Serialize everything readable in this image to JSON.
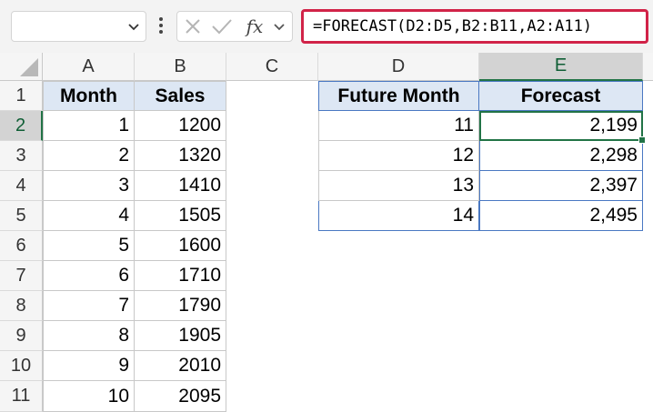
{
  "formula_bar": {
    "name_box": "",
    "formula": "=FORECAST(D2:D5,B2:B11,A2:A11)",
    "fx_label": "fx",
    "icons": [
      "chevron-down-icon",
      "more-vertical-icon",
      "cancel-icon",
      "enter-check-icon",
      "function-icon"
    ]
  },
  "columns": [
    "A",
    "B",
    "C",
    "D",
    "E"
  ],
  "rows": [
    "1",
    "2",
    "3",
    "4",
    "5",
    "6",
    "7",
    "8",
    "9",
    "10",
    "11"
  ],
  "active_cell": {
    "column": "E",
    "row": "2"
  },
  "table_left": {
    "headers": [
      "Month",
      "Sales"
    ],
    "rows": [
      [
        "1",
        "1200"
      ],
      [
        "2",
        "1320"
      ],
      [
        "3",
        "1410"
      ],
      [
        "4",
        "1505"
      ],
      [
        "5",
        "1600"
      ],
      [
        "6",
        "1710"
      ],
      [
        "7",
        "1790"
      ],
      [
        "8",
        "1905"
      ],
      [
        "9",
        "2010"
      ],
      [
        "10",
        "2095"
      ]
    ]
  },
  "table_right": {
    "headers": [
      "Future Month",
      "Forecast"
    ],
    "rows": [
      [
        "11",
        "2,199"
      ],
      [
        "12",
        "2,298"
      ],
      [
        "13",
        "2,397"
      ],
      [
        "14",
        "2,495"
      ]
    ]
  },
  "colors": {
    "accent": "#217346",
    "highlight_border": "#d12348",
    "header_fill": "#dde7f4",
    "table_border": "#4a78c2"
  }
}
